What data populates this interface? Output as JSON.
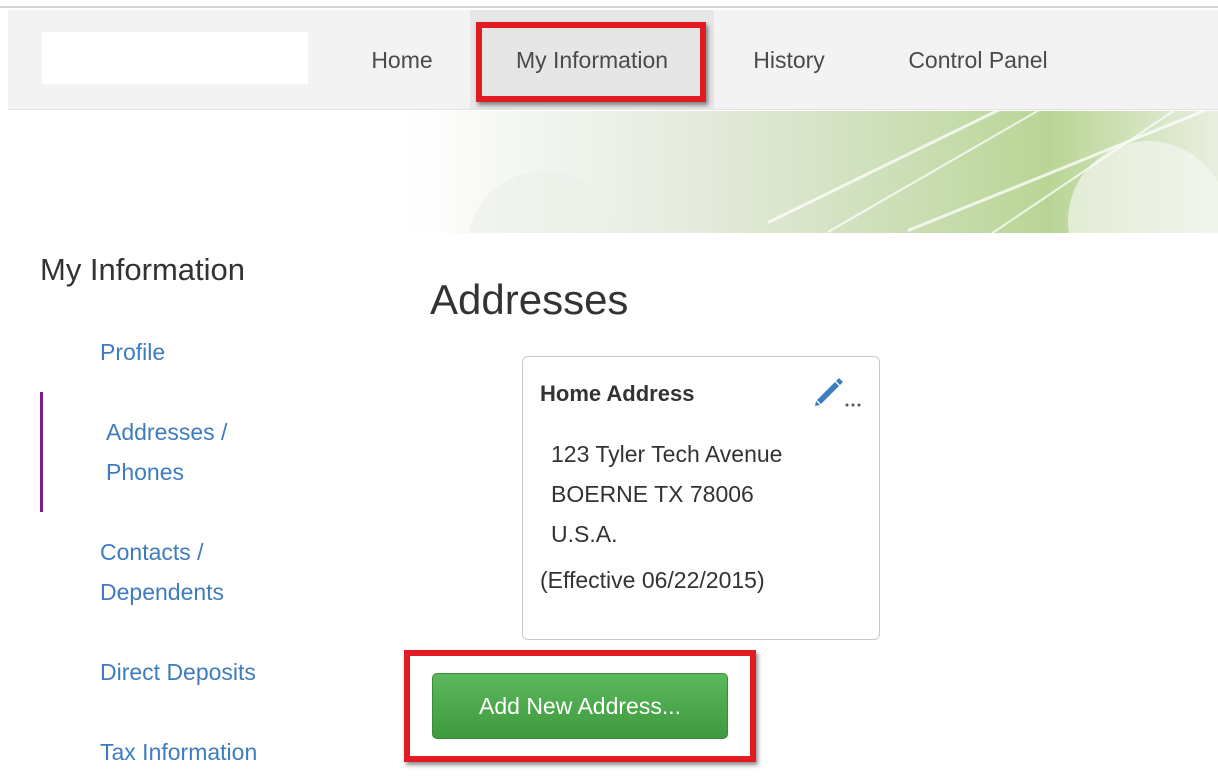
{
  "nav": {
    "items": [
      {
        "label": "Home"
      },
      {
        "label": "My Information",
        "active": true
      },
      {
        "label": "History"
      },
      {
        "label": "Control Panel"
      }
    ]
  },
  "sidebar": {
    "title": "My Information",
    "items": [
      {
        "label": "Profile"
      },
      {
        "label": "Addresses / Phones",
        "line1": "Addresses /",
        "line2": "Phones",
        "active": true
      },
      {
        "label": "Contacts / Dependents",
        "line1": "Contacts /",
        "line2": "Dependents"
      },
      {
        "label": "Direct Deposits"
      },
      {
        "label": "Tax Information"
      }
    ]
  },
  "main": {
    "title": "Addresses",
    "card": {
      "title": "Home Address",
      "edit_icon": "pencil-icon",
      "lines": [
        "123 Tyler Tech Avenue",
        "BOERNE TX 78006",
        "U.S.A."
      ],
      "effective": "(Effective 06/22/2015)"
    },
    "add_button": "Add New Address..."
  },
  "colors": {
    "link": "#3e7cc0",
    "active_bar": "#7a1f8a",
    "highlight": "#e11b22",
    "button": "#4cae4c"
  }
}
